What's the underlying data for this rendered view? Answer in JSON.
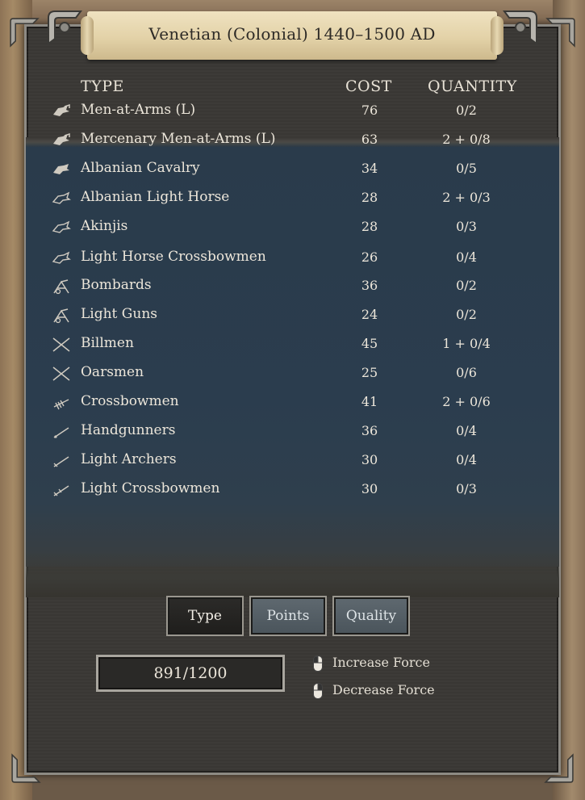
{
  "title": "Venetian (Colonial) 1440–1500 AD",
  "headers": {
    "type": "TYPE",
    "cost": "COST",
    "quantity": "QUANTITY"
  },
  "units": [
    {
      "icon": "heavy-cavalry-icon",
      "name": "Men-at-Arms (L)",
      "cost": "76",
      "quantity": "0/2"
    },
    {
      "icon": "heavy-cavalry-icon",
      "name": "Mercenary Men-at-Arms (L)",
      "cost": "63",
      "quantity": "2 + 0/8"
    },
    {
      "icon": "cavalry-icon",
      "name": "Albanian Cavalry",
      "cost": "34",
      "quantity": "0/5"
    },
    {
      "icon": "light-horse-icon",
      "name": "Albanian Light Horse",
      "cost": "28",
      "quantity": "2 + 0/3"
    },
    {
      "icon": "light-horse-icon",
      "name": "Akinjis",
      "cost": "28",
      "quantity": "0/3"
    },
    {
      "icon": "light-horse-icon",
      "name": "Light Horse Crossbowmen",
      "cost": "26",
      "quantity": "0/4"
    },
    {
      "icon": "artillery-icon",
      "name": "Bombards",
      "cost": "36",
      "quantity": "0/2"
    },
    {
      "icon": "artillery-icon",
      "name": "Light Guns",
      "cost": "24",
      "quantity": "0/2"
    },
    {
      "icon": "crossed-pikes-icon",
      "name": "Billmen",
      "cost": "45",
      "quantity": "1 + 0/4"
    },
    {
      "icon": "crossed-pikes-icon",
      "name": "Oarsmen",
      "cost": "25",
      "quantity": "0/6"
    },
    {
      "icon": "crossbow-icon",
      "name": "Crossbowmen",
      "cost": "41",
      "quantity": "2 + 0/6"
    },
    {
      "icon": "handgun-icon",
      "name": "Handgunners",
      "cost": "36",
      "quantity": "0/4"
    },
    {
      "icon": "bow-icon",
      "name": "Light Archers",
      "cost": "30",
      "quantity": "0/4"
    },
    {
      "icon": "bow-icon",
      "name": "Light Crossbowmen",
      "cost": "30",
      "quantity": "0/3"
    }
  ],
  "sort_buttons": [
    {
      "label": "Type",
      "active": true
    },
    {
      "label": "Points",
      "active": false
    },
    {
      "label": "Quality",
      "active": false
    }
  ],
  "points": "891/1200",
  "hints": [
    {
      "icon": "mouse-left-click-icon",
      "label": "Increase Force"
    },
    {
      "icon": "mouse-right-click-icon",
      "label": "Decrease Force"
    }
  ]
}
